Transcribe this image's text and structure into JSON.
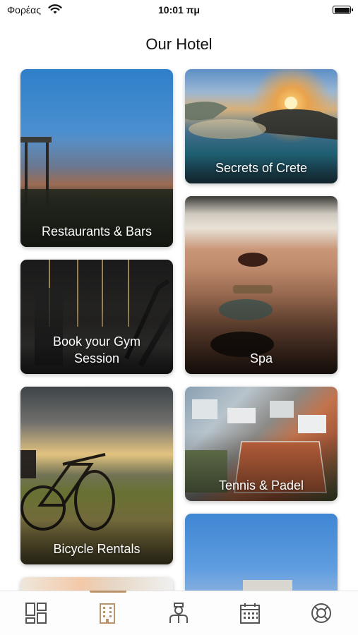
{
  "status_bar": {
    "carrier": "Φορέας",
    "time": "10:01 πμ"
  },
  "header": {
    "title": "Our Hotel"
  },
  "cards": [
    {
      "id": "restaurants",
      "label": "Restaurants & Bars"
    },
    {
      "id": "crete",
      "label": "Secrets of Crete"
    },
    {
      "id": "gym",
      "label": "Book your Gym\nSession"
    },
    {
      "id": "spa",
      "label": "Spa"
    },
    {
      "id": "bicycle",
      "label": "Bicycle Rentals"
    },
    {
      "id": "tennis",
      "label": "Tennis & Padel"
    }
  ],
  "tabbar": {
    "tabs": [
      {
        "icon": "dashboard-icon",
        "active": false
      },
      {
        "icon": "hotel-building-icon",
        "active": true
      },
      {
        "icon": "concierge-icon",
        "active": false
      },
      {
        "icon": "calendar-icon",
        "active": false
      },
      {
        "icon": "lifebuoy-icon",
        "active": false
      }
    ],
    "colors": {
      "active": "#b8936c",
      "inactive": "#555555"
    }
  }
}
